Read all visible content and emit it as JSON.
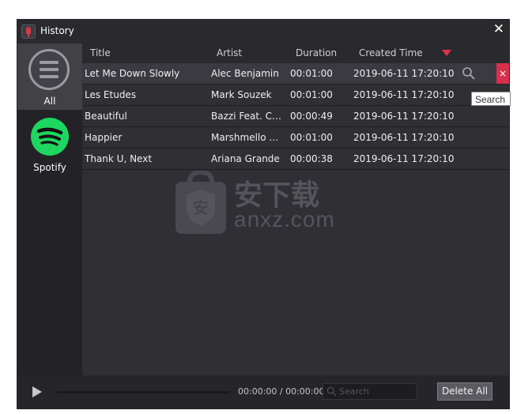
{
  "window": {
    "title": "History"
  },
  "sidebar": {
    "items": [
      {
        "label": "All",
        "icon": "list-icon",
        "active": true
      },
      {
        "label": "Spotify",
        "icon": "spotify-icon",
        "active": false
      }
    ]
  },
  "table": {
    "columns": [
      "Title",
      "Artist",
      "Duration",
      "Created Time"
    ],
    "rows": [
      {
        "title": "Let Me Down Slowly",
        "artist": "Alec Benjamin",
        "duration": "00:01:00",
        "created": "2019-06-11 17:20:10"
      },
      {
        "title": "Les Etudes",
        "artist": "Mark Souzek",
        "duration": "00:01:00",
        "created": "2019-06-11 17:20:10"
      },
      {
        "title": "Beautiful",
        "artist": "Bazzi Feat. Ca...",
        "duration": "00:00:49",
        "created": "2019-06-11 17:20:10"
      },
      {
        "title": "Happier",
        "artist": "Marshmello & B...",
        "duration": "00:01:00",
        "created": "2019-06-11 17:20:10"
      },
      {
        "title": "Thank U, Next",
        "artist": "Ariana Grande",
        "duration": "00:00:38",
        "created": "2019-06-11 17:20:10"
      }
    ],
    "row_actions": {
      "delete": "×"
    },
    "tooltip": "Search"
  },
  "watermark": {
    "cn": "安下载",
    "text": "anxz.com",
    "shield": "安"
  },
  "player": {
    "time": "00:00:00 / 00:00:00"
  },
  "search": {
    "placeholder": "Search"
  },
  "actions": {
    "delete_all": "Delete All"
  },
  "colors": {
    "accent": "#d8304a",
    "spotify": "#1ed760",
    "background": "#2f2f34"
  }
}
